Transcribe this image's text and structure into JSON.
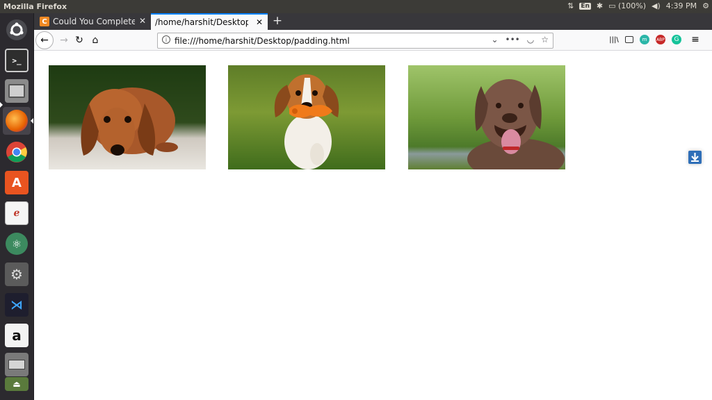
{
  "system_bar": {
    "app_title": "Mozilla Firefox",
    "keyboard_layout": "En",
    "battery": "(100%)",
    "clock": "4:39 PM"
  },
  "launcher": {
    "items": [
      "ubuntu-logo",
      "terminal",
      "files",
      "firefox",
      "chrome",
      "software-center",
      "document-viewer",
      "atom",
      "system-settings",
      "vscode",
      "amazon",
      "printer",
      "drive"
    ]
  },
  "tabs": [
    {
      "title": "Could You Complete Bo",
      "favicon": "C",
      "active": false
    },
    {
      "title": "/home/harshit/Desktop/ro",
      "active": true
    }
  ],
  "navbar": {
    "url": "file:///home/harshit/Desktop/padding.html",
    "toolbar_icons": [
      "library-icon",
      "sidebar-icon",
      "extension-m-icon",
      "adblock-icon",
      "grammarly-icon",
      "menu-icon"
    ]
  },
  "page": {
    "images": [
      {
        "subject": "dachshund lying down"
      },
      {
        "subject": "beagle puppy with orange toy"
      },
      {
        "subject": "chocolate labrador smiling"
      }
    ]
  },
  "colors": {
    "system_bar": "#3c3b37",
    "launcher": "#2c2a2f",
    "tabstrip": "#38373b",
    "active_tab_accent": "#0a84ff"
  }
}
